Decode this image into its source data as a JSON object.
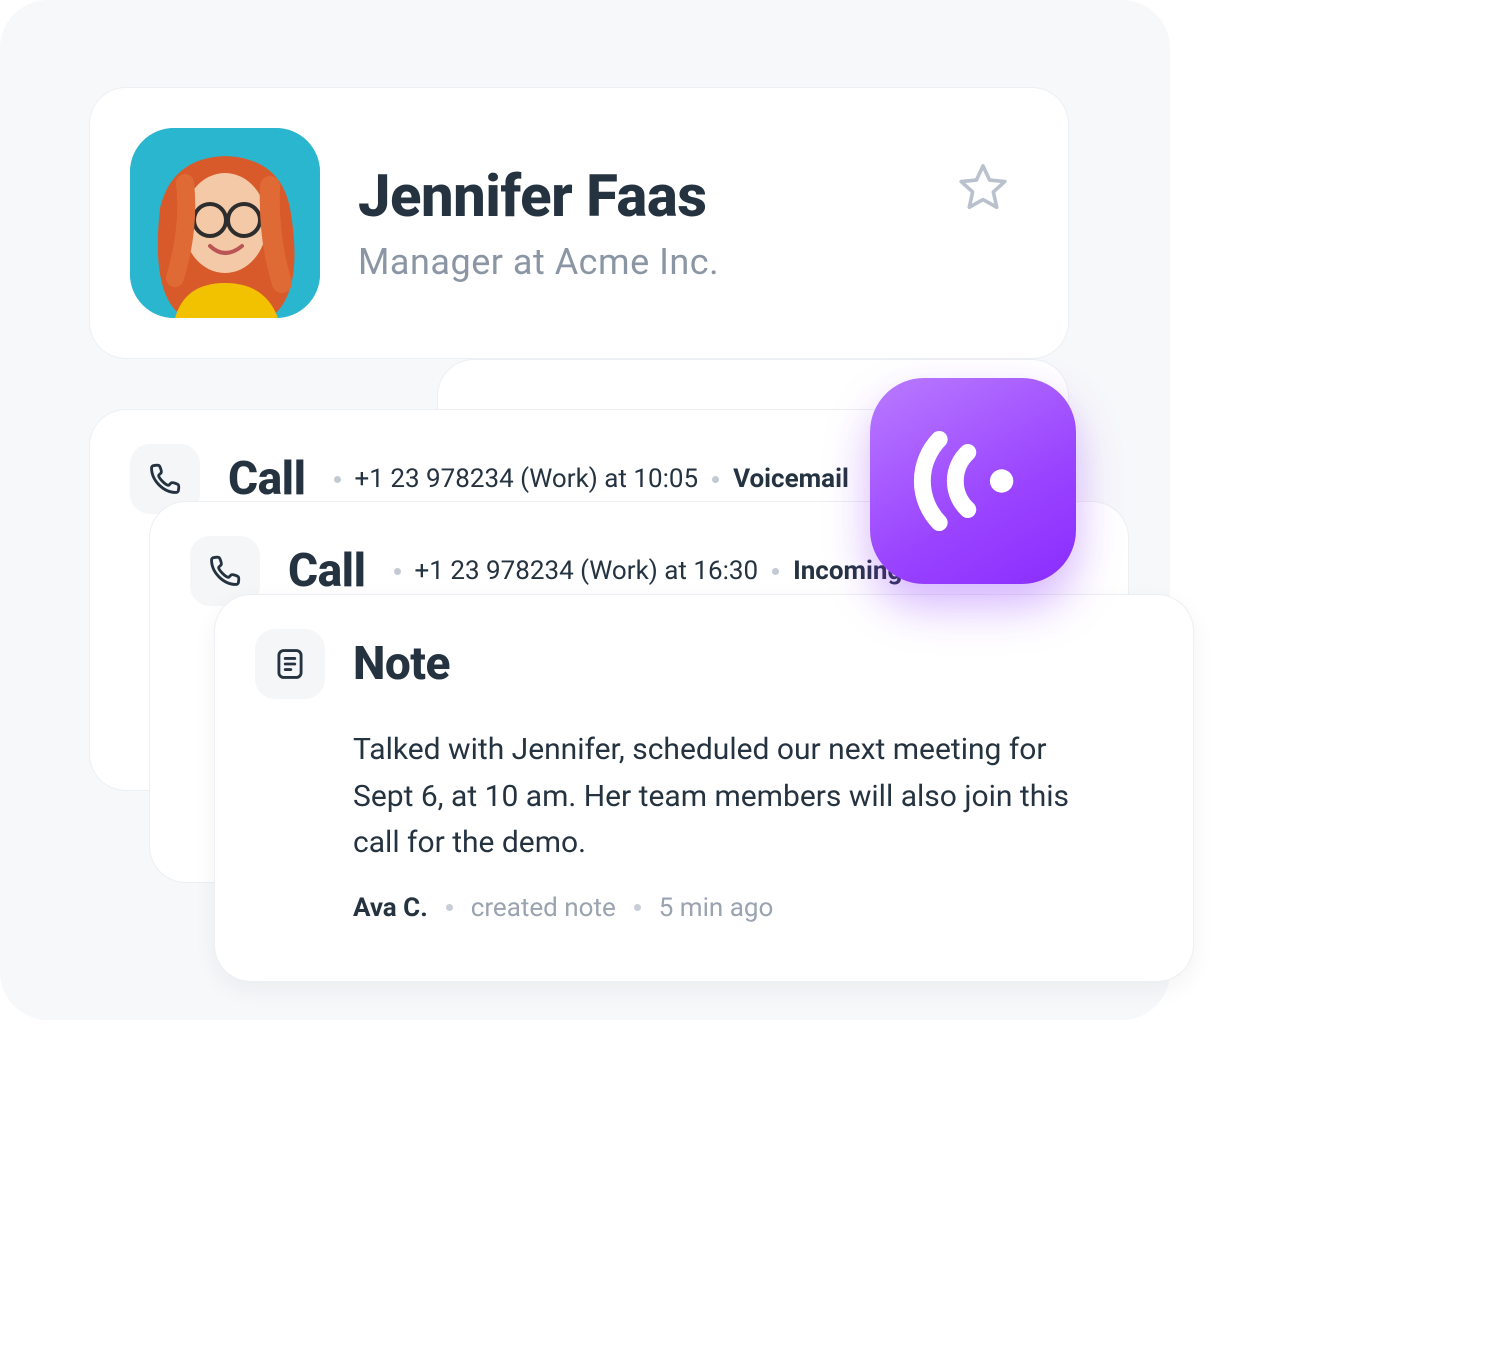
{
  "contact": {
    "name": "Jennifer Faas",
    "title": "Manager at Acme Inc."
  },
  "activities": [
    {
      "type": "call",
      "heading": "Call",
      "number": "+1 23 978234 (Work) at 10:05",
      "status": "Voicemail"
    },
    {
      "type": "call",
      "heading": "Call",
      "number": "+1 23 978234 (Work) at 16:30",
      "status": "Incoming call"
    }
  ],
  "note": {
    "heading": "Note",
    "body": "Talked with Jennifer, scheduled our next meeting for Sept 6, at 10 am. Her team members will also join this call for the demo.",
    "author": "Ava C.",
    "action": "created note",
    "time": "5 min ago"
  }
}
